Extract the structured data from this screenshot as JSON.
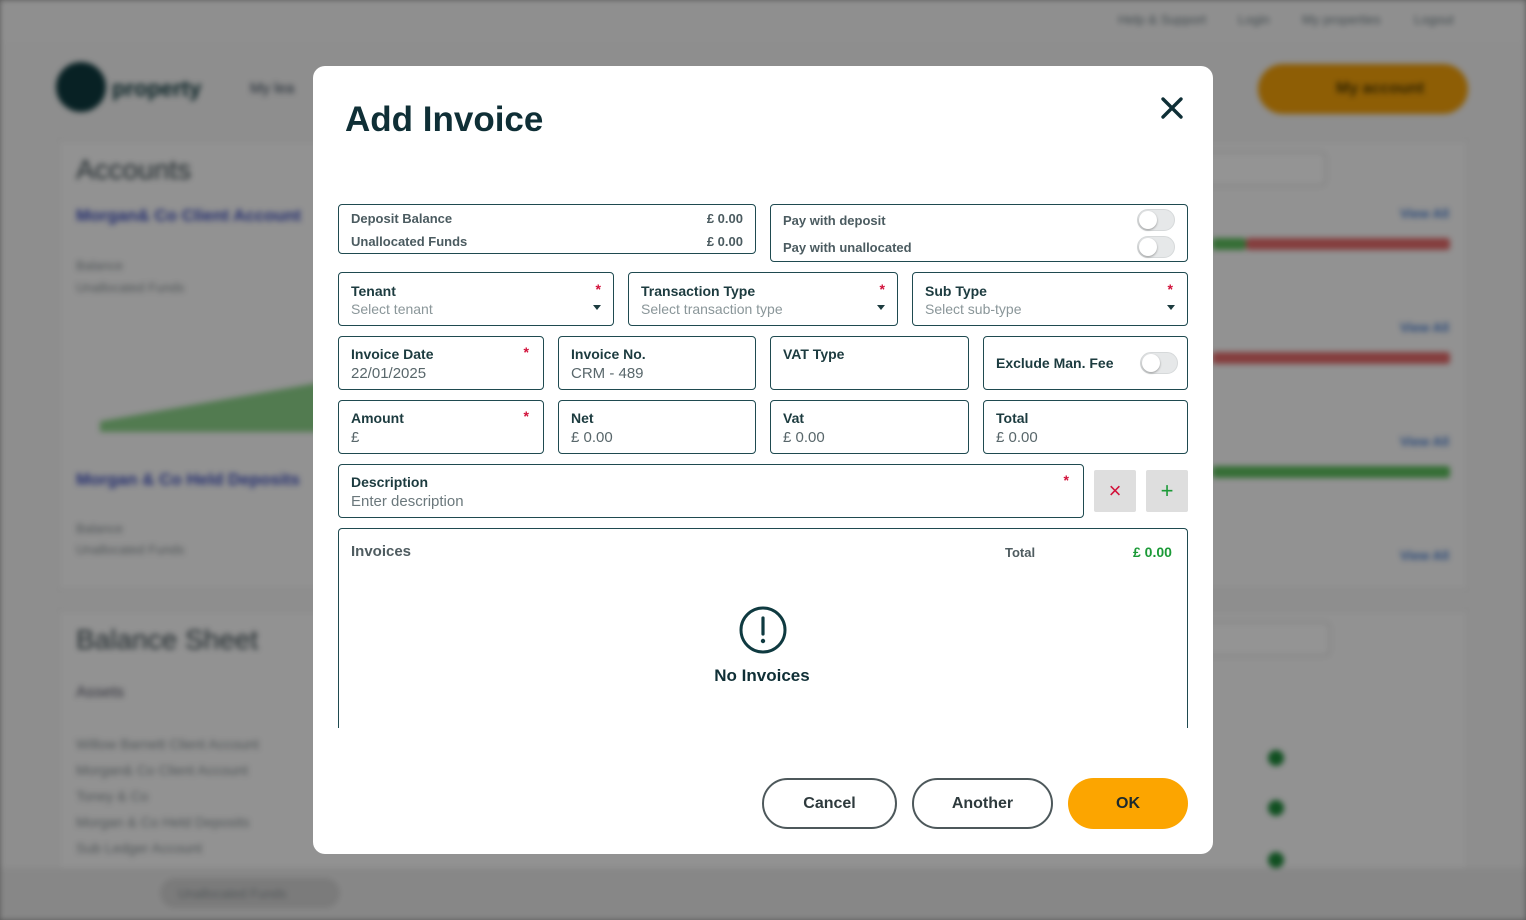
{
  "background": {
    "top_links": [
      "Help & Support",
      "Login",
      "My properties",
      "Logout"
    ],
    "logo_text": "property",
    "nav_text": "My lea",
    "my_account_label": "My account",
    "accounts_heading": "Accounts",
    "account_1": "Morgan& Co Client Account",
    "account_2": "Morgan & Co Held Deposits",
    "balance_label": "Balance",
    "unallocated_label": "Unallocated Funds",
    "balance_sheet_heading": "Balance Sheet",
    "assets_label": "Assets",
    "asset_rows": [
      "Willow Barnett Client Account",
      "Morgan& Co Client Account",
      "Toney & Co",
      "Morgan & Co Held Deposits",
      "Sub Ledger Account"
    ],
    "view_all": "View All",
    "bottom_pill": "Unallocated Funds"
  },
  "modal": {
    "title": "Add Invoice",
    "deposit_balance_label": "Deposit Balance",
    "deposit_balance_value": "£ 0.00",
    "unallocated_funds_label": "Unallocated Funds",
    "unallocated_funds_value": "£ 0.00",
    "pay_with_deposit_label": "Pay with deposit",
    "pay_with_deposit_on": false,
    "pay_with_unallocated_label": "Pay with unallocated",
    "pay_with_unallocated_on": false,
    "tenant": {
      "label": "Tenant",
      "placeholder": "Select tenant",
      "required": "*"
    },
    "transaction_type": {
      "label": "Transaction Type",
      "placeholder": "Select transaction type",
      "required": "*"
    },
    "sub_type": {
      "label": "Sub Type",
      "placeholder": "Select sub-type",
      "required": "*"
    },
    "invoice_date": {
      "label": "Invoice Date",
      "value": "22/01/2025",
      "required": "*"
    },
    "invoice_no": {
      "label": "Invoice No.",
      "value": "CRM - 489"
    },
    "vat_type": {
      "label": "VAT Type",
      "value": ""
    },
    "exclude_man_fee": {
      "label": "Exclude Man. Fee",
      "on": false
    },
    "amount": {
      "label": "Amount",
      "value": "£",
      "required": "*"
    },
    "net": {
      "label": "Net",
      "value": "£ 0.00"
    },
    "vat": {
      "label": "Vat",
      "value": "£ 0.00"
    },
    "total": {
      "label": "Total",
      "value": "£ 0.00"
    },
    "description": {
      "label": "Description",
      "placeholder": "Enter description",
      "required": "*"
    },
    "clear_symbol": "×",
    "add_symbol": "+",
    "invoices": {
      "title": "Invoices",
      "total_label": "Total",
      "total_value": "£ 0.00",
      "empty_text": "No Invoices"
    },
    "buttons": {
      "cancel": "Cancel",
      "another": "Another",
      "ok": "OK"
    }
  },
  "colors": {
    "accent": "#fca500",
    "required": "#d2113a",
    "total_green": "#1b9a37",
    "border": "#1f4a50"
  }
}
